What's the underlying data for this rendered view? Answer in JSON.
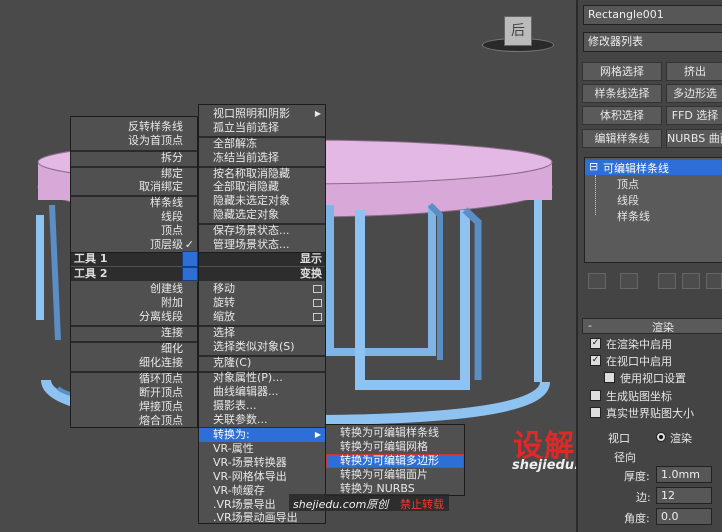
{
  "viewcube": {
    "label": "后"
  },
  "quad_left": {
    "items": [
      "反转样条线",
      "设为首顶点",
      "拆分",
      "绑定",
      "取消绑定",
      "样条线",
      "线段",
      "顶点",
      "顶层级",
      "创建线",
      "附加",
      "分离线段",
      "连接",
      "细化",
      "细化连接",
      "循环顶点",
      "断开顶点",
      "焊接顶点",
      "熔合顶点"
    ],
    "tools1": "工具 1",
    "tools2": "工具 2",
    "check": "✓"
  },
  "quad_right": {
    "items": [
      "视口照明和阴影",
      "孤立当前选择",
      "全部解冻",
      "冻结当前选择",
      "按名称取消隐藏",
      "全部取消隐藏",
      "隐藏未选定对象",
      "隐藏选定对象",
      "保存场景状态...",
      "管理场景状态...",
      "显示",
      "变换",
      "移动",
      "旋转",
      "缩放",
      "选择",
      "选择类似对象(S)",
      "克隆(C)",
      "对象属性(P)...",
      "曲线编辑器...",
      "摄影表...",
      "关联参数...",
      "转换为:",
      "VR-属性",
      "VR-场景转换器",
      "VR-网格体导出",
      "VR-帧缓存",
      ".VR场景导出",
      ".VR场景动画导出"
    ],
    "submenu_arrow": "▶"
  },
  "convert_submenu": {
    "items": [
      "转换为可编辑样条线",
      "转换为可编辑网格",
      "转换为可编辑多边形",
      "转换为可编辑面片",
      "转换为 NURBS"
    ]
  },
  "watermark": {
    "logo": "设解读",
    "url": "shejiedu.com",
    "source": "shejiedu.com原创",
    "forbid": "禁止转载"
  },
  "panel": {
    "object_name": "Rectangle001",
    "modifier_list": "修改器列表",
    "buttons": [
      "网格选择",
      "挤出",
      "样条线选择",
      "多边形选",
      "体积选择",
      "FFD 选择",
      "编辑样条线",
      "NURBS 曲面"
    ],
    "stack": {
      "root_expand": "⊟",
      "root": "可编辑样条线",
      "children": [
        "顶点",
        "线段",
        "样条线"
      ]
    },
    "rollout_toggle": "-",
    "rollout_title": "渲染",
    "checks": [
      {
        "label": "在渲染中启用",
        "checked": true
      },
      {
        "label": "在视口中启用",
        "checked": true
      },
      {
        "label": "使用视口设置",
        "checked": false
      },
      {
        "label": "生成贴图坐标",
        "checked": false
      },
      {
        "label": "真实世界贴图大小",
        "checked": false
      }
    ],
    "viewport_radio": "视口",
    "render_radio": "渲染",
    "radial": "径向",
    "thickness_label": "厚度:",
    "thickness_value": "1.0mm",
    "sides_label": "边:",
    "sides_value": "12",
    "angle_label": "角度:",
    "angle_value": "0.0"
  }
}
